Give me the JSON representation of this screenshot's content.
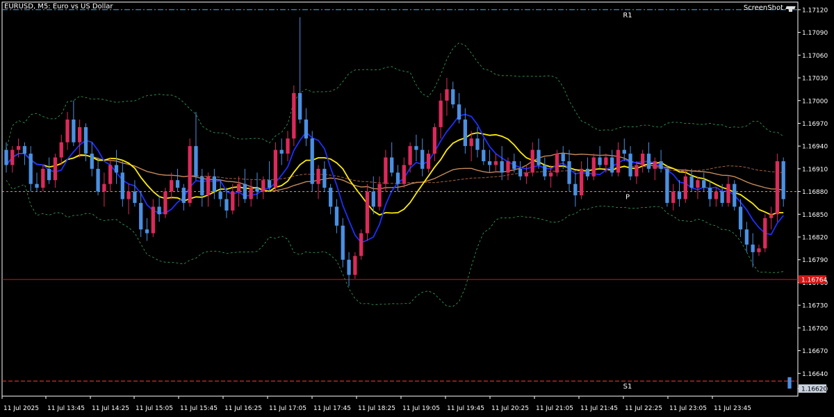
{
  "window": {
    "title": "EURUSD, M5:  Euro vs US Dollar",
    "screenshot_label": "ScreenShot"
  },
  "colors": {
    "background": "#000000",
    "axis": "#ffffff",
    "bull_candle": "#dc2a5a",
    "bear_candle": "#4a90e2",
    "ma_fast": "#1e2fff",
    "ma_mid": "#ffee00",
    "ma_slow": "#c58a5a",
    "ma_long": "#a0623f",
    "envelope": "#3aa85a",
    "pivot_line": "#ff9a3c",
    "r1_line": "#40b8ff",
    "s1_line": "#ff3a3a",
    "price_line": "#d01818"
  },
  "chart_data": {
    "type": "candlestick",
    "symbol": "EURUSD",
    "timeframe": "M5",
    "ylim": [
      1.1661,
      1.1713
    ],
    "y_ticks": [
      "1.17120",
      "1.17090",
      "1.17060",
      "1.17030",
      "1.17000",
      "1.16970",
      "1.16940",
      "1.16910",
      "1.16880",
      "1.16850",
      "1.16820",
      "1.16790",
      "1.16760",
      "1.16730",
      "1.16700",
      "1.16670",
      "1.16640",
      "1.16620"
    ],
    "x_ticks": [
      "11 Jul 2025",
      "11 Jul 13:45",
      "11 Jul 14:25",
      "11 Jul 15:05",
      "11 Jul 15:45",
      "11 Jul 16:25",
      "11 Jul 17:05",
      "11 Jul 17:45",
      "11 Jul 18:25",
      "11 Jul 19:05",
      "11 Jul 19:45",
      "11 Jul 20:25",
      "11 Jul 21:05",
      "11 Jul 21:45",
      "11 Jul 22:25",
      "11 Jul 23:05",
      "11 Jul 23:45"
    ],
    "levels": [
      {
        "label": "R1",
        "value": 1.1712
      },
      {
        "label": "P",
        "value": 1.1688
      },
      {
        "label": "S1",
        "value": 1.1663
      }
    ],
    "current_price_label": "1.16764",
    "current_price": 1.16764,
    "last_price_label": "1.16620",
    "last_price": 1.1662,
    "candles": [
      [
        1.16935,
        1.16945,
        1.16905,
        1.16915
      ],
      [
        1.16915,
        1.1694,
        1.16905,
        1.16935
      ],
      [
        1.16935,
        1.1695,
        1.16925,
        1.1694
      ],
      [
        1.1694,
        1.16945,
        1.16915,
        1.1693
      ],
      [
        1.1693,
        1.1694,
        1.1688,
        1.1689
      ],
      [
        1.1689,
        1.16905,
        1.1688,
        1.16885
      ],
      [
        1.16885,
        1.16915,
        1.1688,
        1.1691
      ],
      [
        1.1691,
        1.16925,
        1.1689,
        1.16895
      ],
      [
        1.16895,
        1.1693,
        1.16885,
        1.16925
      ],
      [
        1.16925,
        1.16955,
        1.16915,
        1.16945
      ],
      [
        1.16945,
        1.16985,
        1.16935,
        1.16975
      ],
      [
        1.16975,
        1.17,
        1.1694,
        1.16945
      ],
      [
        1.16945,
        1.16975,
        1.16925,
        1.16965
      ],
      [
        1.16965,
        1.1697,
        1.1692,
        1.1693
      ],
      [
        1.1693,
        1.16945,
        1.169,
        1.1691
      ],
      [
        1.1691,
        1.16925,
        1.16875,
        1.1688
      ],
      [
        1.1688,
        1.16905,
        1.1686,
        1.1689
      ],
      [
        1.1689,
        1.16925,
        1.1688,
        1.16915
      ],
      [
        1.16915,
        1.16935,
        1.1689,
        1.16905
      ],
      [
        1.16905,
        1.1692,
        1.1686,
        1.1687
      ],
      [
        1.1687,
        1.1689,
        1.1685,
        1.1688
      ],
      [
        1.1688,
        1.16895,
        1.1686,
        1.16865
      ],
      [
        1.16865,
        1.1688,
        1.1682,
        1.1683
      ],
      [
        1.1683,
        1.16845,
        1.16815,
        1.16825
      ],
      [
        1.16825,
        1.1687,
        1.1682,
        1.1686
      ],
      [
        1.1686,
        1.16875,
        1.1684,
        1.1685
      ],
      [
        1.1685,
        1.16885,
        1.16845,
        1.1688
      ],
      [
        1.1688,
        1.16905,
        1.1687,
        1.16895
      ],
      [
        1.16895,
        1.1691,
        1.1688,
        1.16885
      ],
      [
        1.16885,
        1.1689,
        1.16855,
        1.16865
      ],
      [
        1.16865,
        1.1695,
        1.1686,
        1.1694
      ],
      [
        1.1694,
        1.16985,
        1.16895,
        1.169
      ],
      [
        1.169,
        1.1691,
        1.1686,
        1.16875
      ],
      [
        1.16875,
        1.16905,
        1.1686,
        1.169
      ],
      [
        1.169,
        1.1691,
        1.1687,
        1.1688
      ],
      [
        1.1688,
        1.16895,
        1.1686,
        1.1687
      ],
      [
        1.1687,
        1.16885,
        1.16845,
        1.16855
      ],
      [
        1.16855,
        1.1689,
        1.1685,
        1.1688
      ],
      [
        1.1688,
        1.169,
        1.1686,
        1.1689
      ],
      [
        1.1689,
        1.1691,
        1.16865,
        1.1687
      ],
      [
        1.1687,
        1.16895,
        1.1686,
        1.16885
      ],
      [
        1.16885,
        1.16905,
        1.1687,
        1.1688
      ],
      [
        1.1688,
        1.169,
        1.1687,
        1.16895
      ],
      [
        1.16895,
        1.1692,
        1.1688,
        1.16885
      ],
      [
        1.16885,
        1.16945,
        1.1688,
        1.16935
      ],
      [
        1.16935,
        1.1695,
        1.16915,
        1.1693
      ],
      [
        1.1693,
        1.1696,
        1.1692,
        1.1695
      ],
      [
        1.1695,
        1.1702,
        1.1694,
        1.1701
      ],
      [
        1.1701,
        1.1711,
        1.1697,
        1.16975
      ],
      [
        1.16975,
        1.1699,
        1.1694,
        1.1695
      ],
      [
        1.1695,
        1.1696,
        1.1688,
        1.1689
      ],
      [
        1.1689,
        1.16915,
        1.1687,
        1.1691
      ],
      [
        1.1691,
        1.1692,
        1.1688,
        1.16885
      ],
      [
        1.16885,
        1.1689,
        1.1685,
        1.1686
      ],
      [
        1.1686,
        1.1687,
        1.16825,
        1.16835
      ],
      [
        1.16835,
        1.16845,
        1.1678,
        1.1679
      ],
      [
        1.1679,
        1.168,
        1.16755,
        1.1677
      ],
      [
        1.1677,
        1.168,
        1.16765,
        1.16795
      ],
      [
        1.16795,
        1.1683,
        1.1679,
        1.16825
      ],
      [
        1.16825,
        1.1689,
        1.16815,
        1.1688
      ],
      [
        1.1688,
        1.169,
        1.1685,
        1.1686
      ],
      [
        1.1686,
        1.169,
        1.16855,
        1.1689
      ],
      [
        1.1689,
        1.16935,
        1.1688,
        1.16925
      ],
      [
        1.16925,
        1.16945,
        1.169,
        1.16905
      ],
      [
        1.16905,
        1.16915,
        1.1688,
        1.1689
      ],
      [
        1.1689,
        1.16925,
        1.16885,
        1.16915
      ],
      [
        1.16915,
        1.16945,
        1.16905,
        1.1694
      ],
      [
        1.1694,
        1.16955,
        1.1692,
        1.16935
      ],
      [
        1.16935,
        1.1695,
        1.169,
        1.1691
      ],
      [
        1.1691,
        1.16935,
        1.16905,
        1.1693
      ],
      [
        1.1693,
        1.1697,
        1.1692,
        1.16965
      ],
      [
        1.16965,
        1.1701,
        1.1695,
        1.17
      ],
      [
        1.17,
        1.1703,
        1.1698,
        1.17015
      ],
      [
        1.17015,
        1.17025,
        1.1699,
        1.16995
      ],
      [
        1.16995,
        1.1701,
        1.1697,
        1.16975
      ],
      [
        1.16975,
        1.1699,
        1.1693,
        1.1694
      ],
      [
        1.1694,
        1.1696,
        1.1692,
        1.1695
      ],
      [
        1.1695,
        1.16965,
        1.16925,
        1.16935
      ],
      [
        1.16935,
        1.1695,
        1.16915,
        1.1692
      ],
      [
        1.1692,
        1.16935,
        1.16905,
        1.16915
      ],
      [
        1.16915,
        1.1693,
        1.16905,
        1.1692
      ],
      [
        1.1692,
        1.1694,
        1.16895,
        1.16905
      ],
      [
        1.16905,
        1.16925,
        1.16895,
        1.1692
      ],
      [
        1.1692,
        1.1693,
        1.16905,
        1.1691
      ],
      [
        1.1691,
        1.1692,
        1.16895,
        1.169
      ],
      [
        1.169,
        1.16915,
        1.1689,
        1.16905
      ],
      [
        1.16905,
        1.16945,
        1.169,
        1.16935
      ],
      [
        1.16935,
        1.1695,
        1.1691,
        1.16915
      ],
      [
        1.16915,
        1.16925,
        1.16895,
        1.169
      ],
      [
        1.169,
        1.16915,
        1.16885,
        1.16905
      ],
      [
        1.16905,
        1.16935,
        1.169,
        1.1693
      ],
      [
        1.1693,
        1.1694,
        1.1691,
        1.1692
      ],
      [
        1.1692,
        1.16935,
        1.1688,
        1.1689
      ],
      [
        1.1689,
        1.16905,
        1.1686,
        1.16875
      ],
      [
        1.16875,
        1.1692,
        1.1687,
        1.1691
      ],
      [
        1.1691,
        1.16925,
        1.16895,
        1.169
      ],
      [
        1.169,
        1.1693,
        1.16895,
        1.16925
      ],
      [
        1.16925,
        1.1694,
        1.1691,
        1.16915
      ],
      [
        1.16915,
        1.1693,
        1.16905,
        1.16925
      ],
      [
        1.16925,
        1.16935,
        1.169,
        1.16905
      ],
      [
        1.16905,
        1.16945,
        1.169,
        1.16935
      ],
      [
        1.16935,
        1.1695,
        1.1692,
        1.1693
      ],
      [
        1.1693,
        1.1694,
        1.16895,
        1.169
      ],
      [
        1.169,
        1.1692,
        1.1689,
        1.16915
      ],
      [
        1.16915,
        1.16935,
        1.16905,
        1.1693
      ],
      [
        1.1693,
        1.16945,
        1.16905,
        1.1691
      ],
      [
        1.1691,
        1.16925,
        1.16895,
        1.1692
      ],
      [
        1.1692,
        1.16935,
        1.16905,
        1.1691
      ],
      [
        1.1691,
        1.16915,
        1.1686,
        1.16865
      ],
      [
        1.16865,
        1.1689,
        1.16855,
        1.1688
      ],
      [
        1.1688,
        1.16895,
        1.1686,
        1.1687
      ],
      [
        1.1687,
        1.1691,
        1.16865,
        1.169
      ],
      [
        1.169,
        1.1691,
        1.1688,
        1.16885
      ],
      [
        1.16885,
        1.169,
        1.1687,
        1.16895
      ],
      [
        1.16895,
        1.16905,
        1.1688,
        1.16885
      ],
      [
        1.16885,
        1.16895,
        1.1686,
        1.1687
      ],
      [
        1.1687,
        1.16885,
        1.1686,
        1.1688
      ],
      [
        1.1688,
        1.1689,
        1.1686,
        1.16865
      ],
      [
        1.16865,
        1.169,
        1.1686,
        1.1689
      ],
      [
        1.1689,
        1.16895,
        1.16855,
        1.1686
      ],
      [
        1.1686,
        1.1687,
        1.1682,
        1.1683
      ],
      [
        1.1683,
        1.1684,
        1.168,
        1.1681
      ],
      [
        1.1681,
        1.16825,
        1.1678,
        1.168
      ],
      [
        1.168,
        1.1681,
        1.16795,
        1.16805
      ],
      [
        1.16805,
        1.1685,
        1.168,
        1.16845
      ],
      [
        1.16845,
        1.1686,
        1.1683,
        1.1685
      ],
      [
        1.1685,
        1.1693,
        1.1684,
        1.1692
      ],
      [
        1.1692,
        1.16925,
        1.1686,
        1.1687
      ],
      [
        1.16635,
        1.16635,
        1.1662,
        1.1662
      ]
    ]
  }
}
